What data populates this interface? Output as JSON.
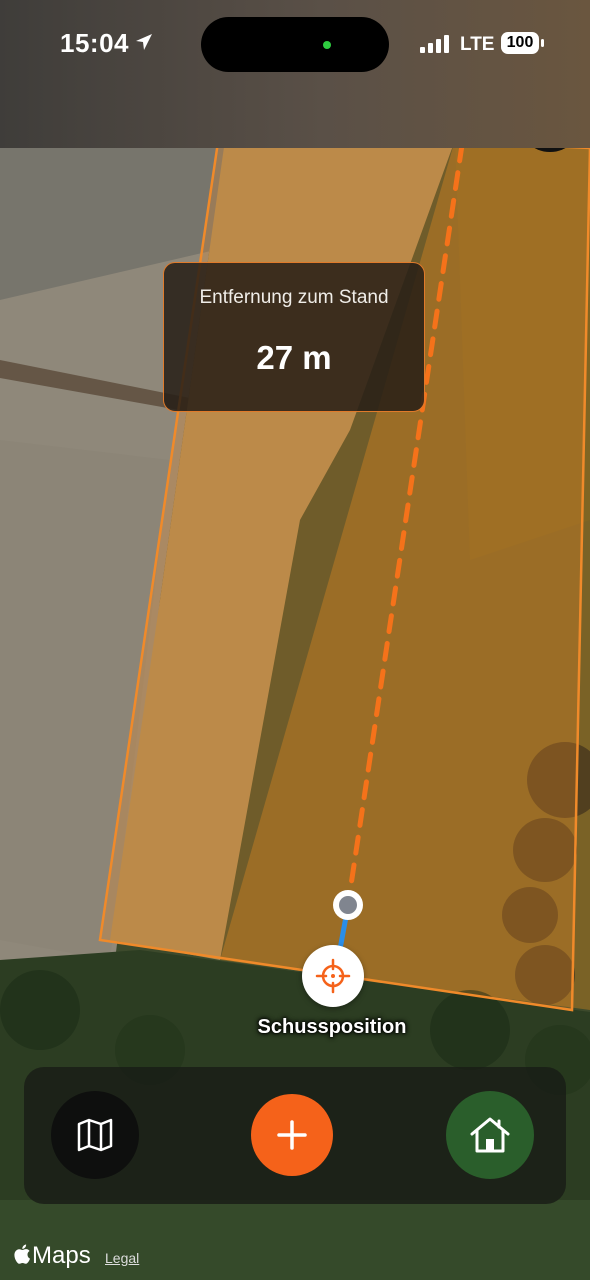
{
  "status_bar": {
    "time": "15:04",
    "network": "LTE",
    "battery": "100"
  },
  "distance_box": {
    "title": "Entfernung zum Stand",
    "value": "27 m"
  },
  "shot_marker": {
    "label": "Schussposition"
  },
  "toolbar": {
    "map_icon": "map-icon",
    "add_icon": "plus-icon",
    "home_icon": "home-icon"
  },
  "footer": {
    "maps_label": "Maps",
    "legal_label": "Legal"
  },
  "colors": {
    "accent": "#f5621a",
    "zone_outline": "#f08a2a",
    "home_button": "#2a5e2b",
    "track_line": "#2a8ee8"
  }
}
